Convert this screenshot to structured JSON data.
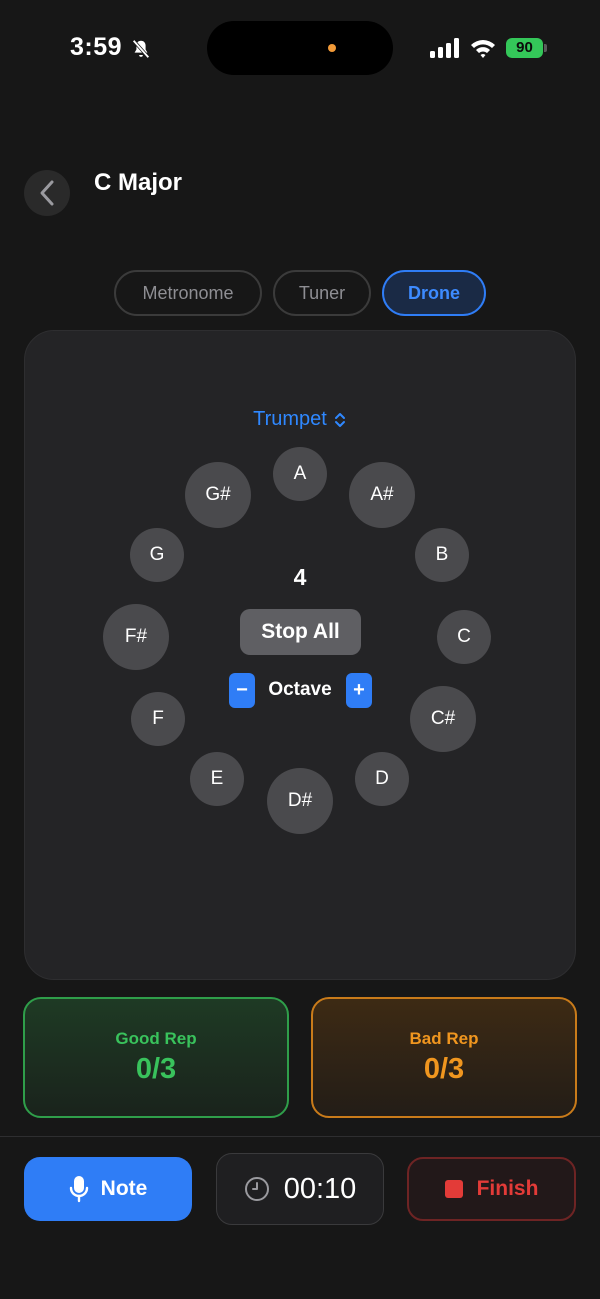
{
  "status_bar": {
    "time": "3:59",
    "battery": "90"
  },
  "header": {
    "title": "C Major"
  },
  "tabs": [
    {
      "label": "Metronome",
      "active": false
    },
    {
      "label": "Tuner",
      "active": false
    },
    {
      "label": "Drone",
      "active": true
    }
  ],
  "drone": {
    "instrument": "Trumpet",
    "octave_value": "4",
    "stop_all_label": "Stop All",
    "octave_label": "Octave",
    "minus_label": "−",
    "plus_label": "+",
    "notes": [
      "A",
      "A#",
      "B",
      "C",
      "C#",
      "D",
      "D#",
      "E",
      "F",
      "F#",
      "G",
      "G#"
    ]
  },
  "reps": {
    "good": {
      "label": "Good Rep",
      "count": "0/3"
    },
    "bad": {
      "label": "Bad Rep",
      "count": "0/3"
    }
  },
  "bottom_bar": {
    "note_label": "Note",
    "timer": "00:10",
    "finish_label": "Finish"
  },
  "colors": {
    "accent": "#2f7df6",
    "good": "#39c25c",
    "bad": "#f0961f",
    "finish": "#e33b38",
    "background": "#171717"
  }
}
